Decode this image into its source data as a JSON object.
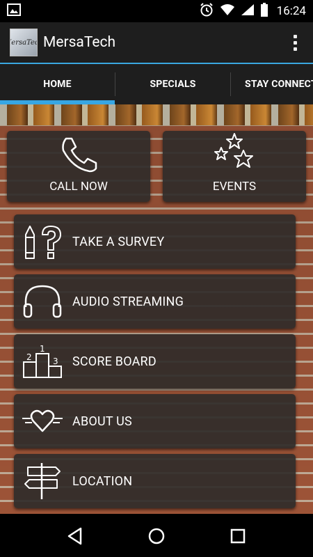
{
  "status_bar": {
    "time": "16:24",
    "icons": [
      "image-icon",
      "alarm-icon",
      "wifi-icon",
      "signal-icon",
      "battery-icon"
    ]
  },
  "app_bar": {
    "logo_text": "MersaTech",
    "title": "MersaTech",
    "overflow_icon": "more-vert-icon"
  },
  "tabs": [
    {
      "label": "HOME",
      "selected": true
    },
    {
      "label": "SPECIALS",
      "selected": false
    },
    {
      "label": "STAY CONNECTED",
      "selected": false
    }
  ],
  "accent_color": "#37a6e3",
  "tiles": {
    "call_now": {
      "label": "CALL NOW",
      "icon": "phone-icon"
    },
    "events": {
      "label": "EVENTS",
      "icon": "stars-icon"
    },
    "take_survey": {
      "label": "TAKE A SURVEY",
      "icon": "pencil-question-icon"
    },
    "audio_streaming": {
      "label": "AUDIO STREAMING",
      "icon": "headphones-icon"
    },
    "score_board": {
      "label": "SCORE BOARD",
      "icon": "podium-icon"
    },
    "about_us": {
      "label": "ABOUT US",
      "icon": "heart-icon"
    },
    "location": {
      "label": "LOCATION",
      "icon": "signpost-icon"
    }
  },
  "nav_bar": {
    "back": "back-icon",
    "home": "home-icon",
    "recents": "recents-icon"
  }
}
